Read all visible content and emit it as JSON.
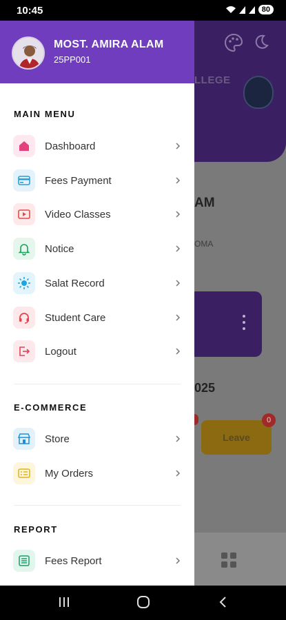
{
  "status_bar": {
    "time": "10:45",
    "battery": "80"
  },
  "profile": {
    "name": "MOST. AMIRA ALAM",
    "id": "25PP001"
  },
  "main_menu": {
    "title": "MAIN MENU",
    "items": [
      {
        "label": "Dashboard",
        "icon": "home-icon",
        "color": "#e4407d"
      },
      {
        "label": "Fees Payment",
        "icon": "credit-card-icon",
        "color": "#2a9fd6"
      },
      {
        "label": "Video Classes",
        "icon": "video-play-icon",
        "color": "#e24a4a"
      },
      {
        "label": "Notice",
        "icon": "bell-icon",
        "color": "#19a05a"
      },
      {
        "label": "Salat Record",
        "icon": "sun-icon",
        "color": "#1ea5e0"
      },
      {
        "label": "Student Care",
        "icon": "headset-icon",
        "color": "#e8434a"
      },
      {
        "label": "Logout",
        "icon": "logout-icon",
        "color": "#e4405a"
      }
    ]
  },
  "ecommerce": {
    "title": "E-COMMERCE",
    "items": [
      {
        "label": "Store",
        "icon": "store-icon",
        "color": "#1e8fd6"
      },
      {
        "label": "My Orders",
        "icon": "orders-icon",
        "color": "#e0b21a"
      }
    ]
  },
  "report": {
    "title": "REPORT",
    "items": [
      {
        "label": "Fees Report",
        "icon": "report-icon",
        "color": "#17a065"
      }
    ]
  },
  "background": {
    "college_fragment": "LLEGE",
    "name_fragment": "AM",
    "sub_fragment": "OMA",
    "year_fragment": "025",
    "leave_label": "Leave",
    "leave_badge": "0"
  }
}
